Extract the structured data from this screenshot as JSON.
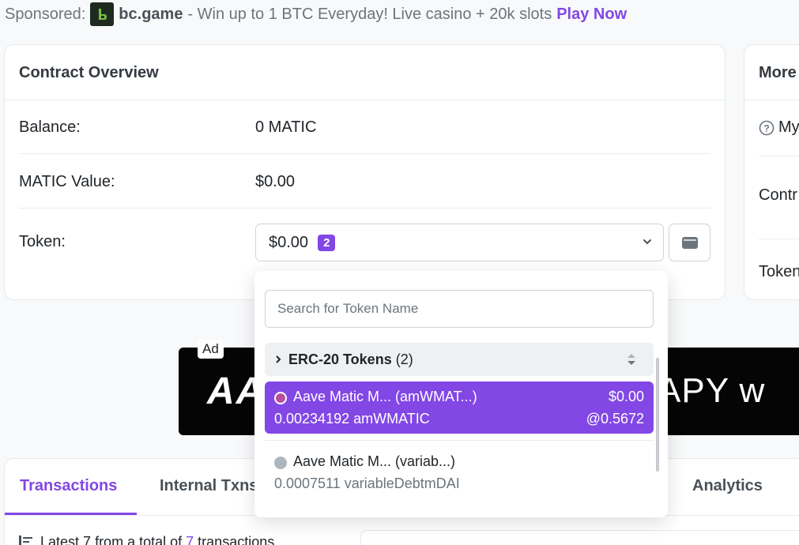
{
  "sponsor": {
    "prefix": "Sponsored:",
    "brand": "bc.game",
    "text": "- Win up to 1 BTC Everyday! Live casino + 20k slots",
    "cta": "Play Now"
  },
  "overview": {
    "title": "Contract Overview",
    "balance_label": "Balance:",
    "balance_value": "0 MATIC",
    "value_label": "MATIC Value:",
    "value_value": "$0.00",
    "token_label": "Token:",
    "token_value": "$0.00",
    "token_count": "2"
  },
  "more_info": {
    "title": "More",
    "item1": "My",
    "item2": "Contr",
    "item3": "Token"
  },
  "ad": {
    "label": "Ad",
    "left_text": "AA",
    "right_text": "APY w"
  },
  "dropdown": {
    "search_placeholder": "Search for Token Name",
    "group_title": "ERC-20 Tokens",
    "group_count": "(2)",
    "items": [
      {
        "name": "Aave Matic M... (amWMAT...)",
        "amount": "0.00234192 amWMATIC",
        "usd": "$0.00",
        "rate": "@0.5672"
      },
      {
        "name": "Aave Matic M... (variab...)",
        "amount": "0.0007511 variableDebtmDAI"
      }
    ]
  },
  "tabs": {
    "transactions": "Transactions",
    "internal": "Internal Txns",
    "analytics": "Analytics"
  },
  "latest": {
    "prefix": "Latest 7 from a total of",
    "count": "7",
    "suffix": "transactions"
  },
  "colors": {
    "accent": "#8247e5",
    "text": "#212529",
    "muted": "#6c757d"
  }
}
